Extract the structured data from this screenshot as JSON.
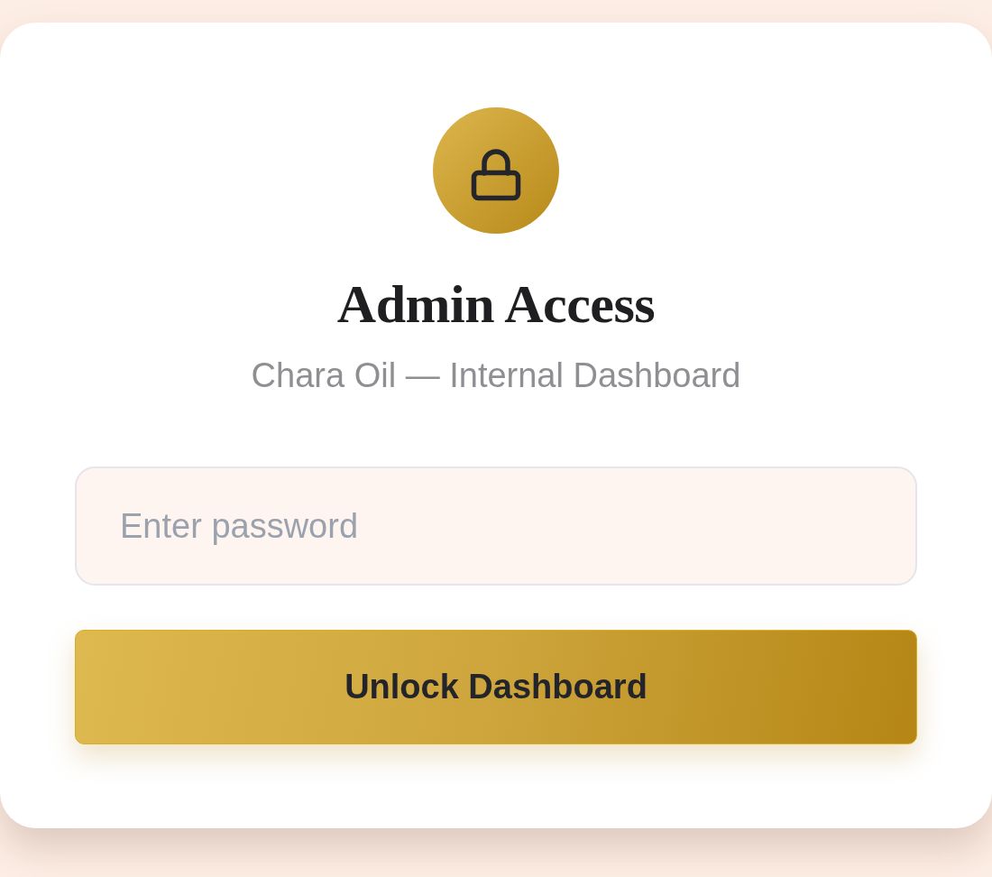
{
  "header": {
    "title": "Admin Access",
    "subtitle": "Chara Oil — Internal Dashboard"
  },
  "form": {
    "password_field": {
      "placeholder": "Enter password"
    },
    "submit_button": {
      "label": "Unlock Dashboard"
    }
  }
}
